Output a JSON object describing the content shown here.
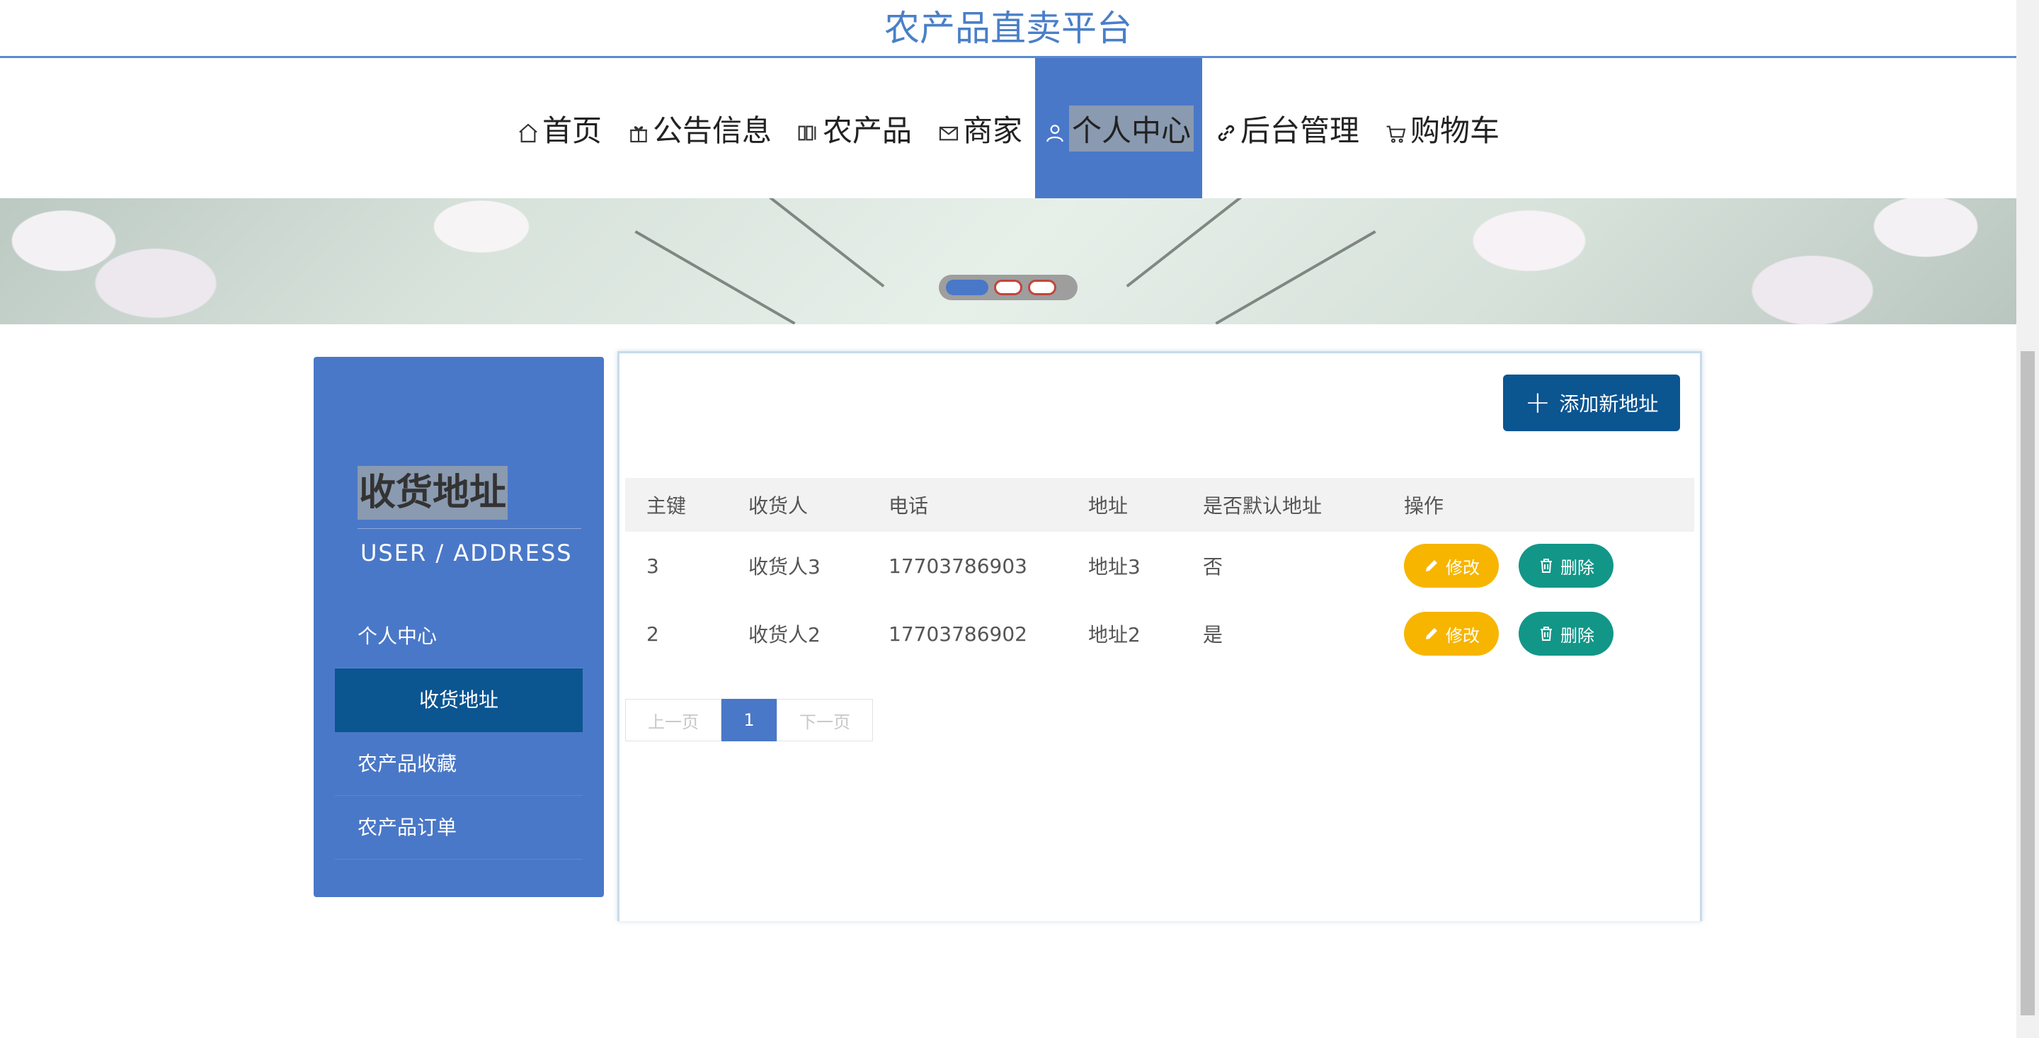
{
  "site": {
    "title": "农产品直卖平台"
  },
  "nav": {
    "items": [
      {
        "label": "首页",
        "icon": "home-icon"
      },
      {
        "label": "公告信息",
        "icon": "gift-icon"
      },
      {
        "label": "农产品",
        "icon": "columns-icon"
      },
      {
        "label": "商家",
        "icon": "mail-icon"
      },
      {
        "label": "个人中心",
        "icon": "user-icon"
      },
      {
        "label": "后台管理",
        "icon": "link-icon"
      },
      {
        "label": "购物车",
        "icon": "cart-icon"
      }
    ],
    "active_index": 4
  },
  "carousel": {
    "slides": 3,
    "active": 0
  },
  "sidebar": {
    "title": "收货地址",
    "subtitle": "USER / ADDRESS",
    "items": [
      {
        "label": "个人中心"
      },
      {
        "label": "收货地址"
      },
      {
        "label": "农产品收藏"
      },
      {
        "label": "农产品订单"
      }
    ],
    "active_index": 1
  },
  "main": {
    "add_button": "添加新地址",
    "columns": [
      "主键",
      "收货人",
      "电话",
      "地址",
      "是否默认地址",
      "操作"
    ],
    "rows": [
      {
        "id": "3",
        "name": "收货人3",
        "phone": "17703786903",
        "address": "地址3",
        "is_default": "否"
      },
      {
        "id": "2",
        "name": "收货人2",
        "phone": "17703786902",
        "address": "地址2",
        "is_default": "是"
      }
    ],
    "edit_label": "修改",
    "delete_label": "删除",
    "pagination": {
      "prev": "上一页",
      "current": "1",
      "next": "下一页"
    }
  },
  "colors": {
    "primary": "#4a78c8",
    "dark_blue": "#0b5591",
    "edit_yellow": "#f7b500",
    "delete_teal": "#129688",
    "title_blue": "#4a7fc8"
  }
}
